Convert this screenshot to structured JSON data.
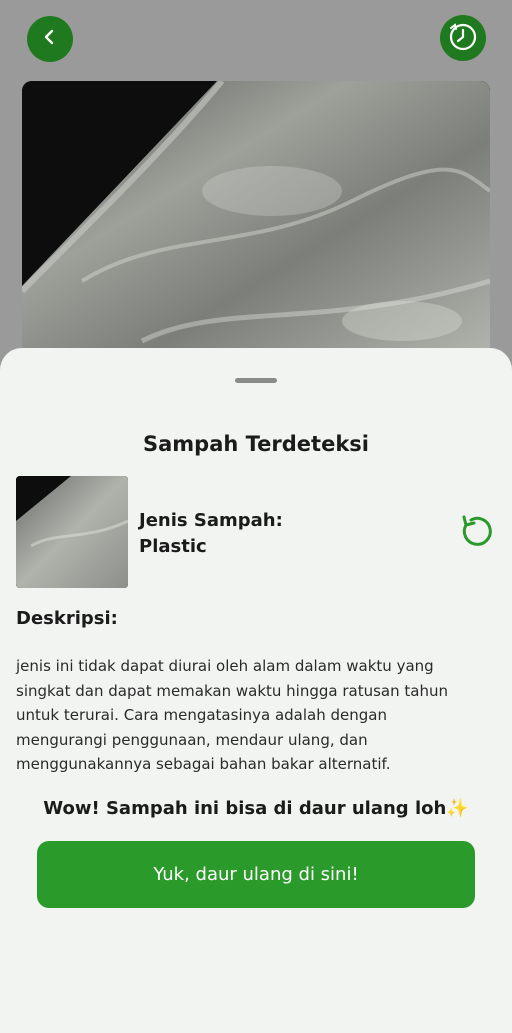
{
  "header": {
    "back_icon": "chevron-left-icon",
    "history_icon": "history-clock-icon",
    "accent_color": "#1f7a1f"
  },
  "sheet": {
    "title": "Sampah Terdeteksi",
    "waste_type_label": "Jenis Sampah:",
    "waste_type_value": "Plastic",
    "retry_icon": "refresh-icon",
    "description_heading": "Deskripsi:",
    "description_lines": [
      "jenis ini tidak dapat diurai oleh alam dalam waktu yang",
      "singkat dan dapat memakan waktu hingga ratusan tahun",
      "untuk terurai. Cara mengatasinya adalah dengan",
      "mengurangi penggunaan, mendaur ulang, dan",
      "menggunakannya sebagai bahan bakar alternatif."
    ],
    "recycle_message": "Wow! Sampah ini bisa di daur ulang loh✨",
    "cta_label": "Yuk, daur ulang di sini!",
    "cta_color": "#2a9a2a"
  }
}
